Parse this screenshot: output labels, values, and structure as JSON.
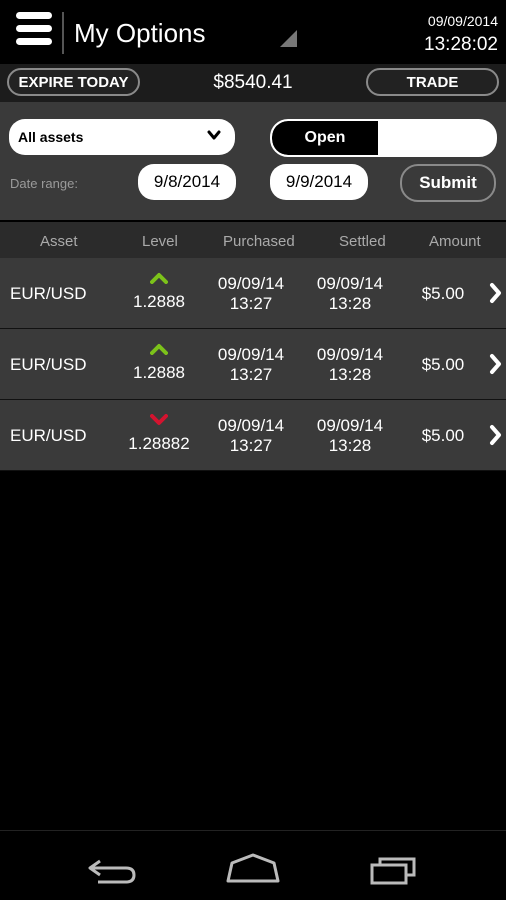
{
  "header": {
    "title": "My Options",
    "date": "09/09/2014",
    "time": "13:28:02"
  },
  "balance_bar": {
    "expire_label": "EXPIRE TODAY",
    "balance": "$8540.41",
    "trade_label": "TRADE"
  },
  "filters": {
    "asset_value": "All assets",
    "toggle_selected": "Open",
    "toggle_other": "",
    "date_range_label": "Date range:",
    "date_from": "9/8/2014",
    "date_to": "9/9/2014",
    "submit_label": "Submit"
  },
  "table": {
    "columns": [
      "Asset",
      "Level",
      "Purchased",
      "Settled",
      "Amount"
    ],
    "rows": [
      {
        "asset": "EUR/USD",
        "direction": "up",
        "level": "1.2888",
        "purchased_date": "09/09/14",
        "purchased_time": "13:27",
        "settled_date": "09/09/14",
        "settled_time": "13:28",
        "amount": "$5.00"
      },
      {
        "asset": "EUR/USD",
        "direction": "up",
        "level": "1.2888",
        "purchased_date": "09/09/14",
        "purchased_time": "13:27",
        "settled_date": "09/09/14",
        "settled_time": "13:28",
        "amount": "$5.00"
      },
      {
        "asset": "EUR/USD",
        "direction": "down",
        "level": "1.28882",
        "purchased_date": "09/09/14",
        "purchased_time": "13:27",
        "settled_date": "09/09/14",
        "settled_time": "13:28",
        "amount": "$5.00"
      }
    ]
  },
  "colors": {
    "up": "#7cc21a",
    "down": "#d4132f"
  },
  "icons": {
    "menu": "hamburger-icon",
    "up": "chevron-up-icon",
    "down": "chevron-down-icon",
    "row": "chevron-right-icon",
    "back": "back-icon",
    "home": "home-icon",
    "recents": "recents-icon"
  }
}
